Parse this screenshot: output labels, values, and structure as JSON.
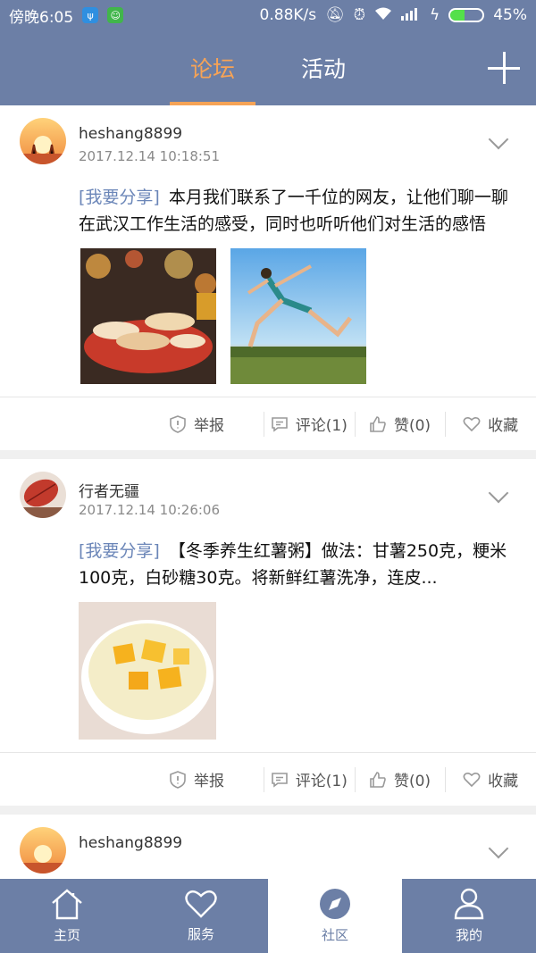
{
  "status_bar": {
    "time": "傍晚6:05",
    "speed": "0.88K/s",
    "battery_percent": "45%",
    "battery_level": 0.45
  },
  "top_nav": {
    "tabs": [
      {
        "label": "论坛",
        "active": true
      },
      {
        "label": "活动",
        "active": false
      }
    ]
  },
  "posts": [
    {
      "username": "heshang8899",
      "timestamp": "2017.12.14 10:18:51",
      "tag": "[我要分享]",
      "text": "本月我们联系了一千位的网友，让他们聊一聊在武汉工作生活的感受，同时也听听他们对生活的感悟",
      "images": [
        "food-market-photo",
        "jumping-woman-photo"
      ],
      "actions": {
        "report": "举报",
        "comment": "评论(1)",
        "like": "赞(0)",
        "favorite": "收藏"
      }
    },
    {
      "username": "行者无疆",
      "timestamp": "2017.12.14 10:26:06",
      "tag": "[我要分享]",
      "text": "【冬季养生红薯粥】做法：甘薯250克，粳米100克，白砂糖30克。将新鲜红薯洗净，连皮...",
      "images": [
        "sweet-potato-porridge-photo"
      ],
      "actions": {
        "report": "举报",
        "comment": "评论(1)",
        "like": "赞(0)",
        "favorite": "收藏"
      }
    },
    {
      "username": "heshang8899"
    }
  ],
  "bottom_tabs": [
    {
      "label": "主页",
      "icon": "home-icon",
      "active": false
    },
    {
      "label": "服务",
      "icon": "heart-icon",
      "active": false
    },
    {
      "label": "社区",
      "icon": "compass-icon",
      "active": true
    },
    {
      "label": "我的",
      "icon": "person-icon",
      "active": false
    }
  ],
  "colors": {
    "primary": "#6c7fa6",
    "accent": "#f6a356",
    "tag": "#6b86b8"
  }
}
